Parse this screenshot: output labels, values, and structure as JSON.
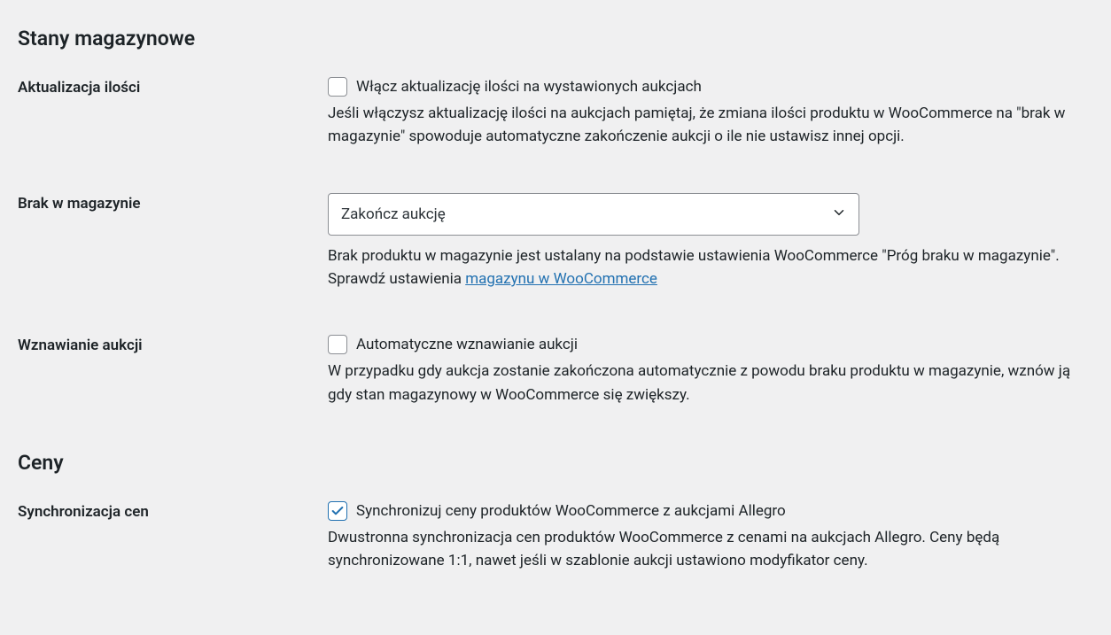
{
  "section_stock": {
    "heading": "Stany magazynowe"
  },
  "quantity_update": {
    "label": "Aktualizacja ilości",
    "checkbox_label": "Włącz aktualizację ilości na wystawionych aukcjach",
    "description": "Jeśli włączysz aktualizację ilości na aukcjach pamiętaj, że zmiana ilości produktu w WooCommerce na \"brak w magazynie\" spowoduje automatyczne zakończenie aukcji o ile nie ustawisz innej opcji."
  },
  "out_of_stock": {
    "label": "Brak w magazynie",
    "selected": "Zakończ aukcję",
    "description_before_link": "Brak produktu w magazynie jest ustalany na podstawie ustawienia WooCommerce \"Próg braku w magazynie\". Sprawdź ustawienia ",
    "link_text": "magazynu w WooCommerce"
  },
  "resume_auction": {
    "label": "Wznawianie aukcji",
    "checkbox_label": "Automatyczne wznawianie aukcji",
    "description": "W przypadku gdy aukcja zostanie zakończona automatycznie z powodu braku produktu w magazynie, wznów ją gdy stan magazynowy w WooCommerce się zwiększy."
  },
  "section_prices": {
    "heading": "Ceny"
  },
  "price_sync": {
    "label": "Synchronizacja cen",
    "checkbox_label": "Synchronizuj ceny produktów WooCommerce z aukcjami Allegro",
    "description": "Dwustronna synchronizacja cen produktów WooCommerce z cenami na aukcjach Allegro. Ceny będą synchronizowane 1:1, nawet jeśli w szablonie aukcji ustawiono modyfikator ceny."
  }
}
